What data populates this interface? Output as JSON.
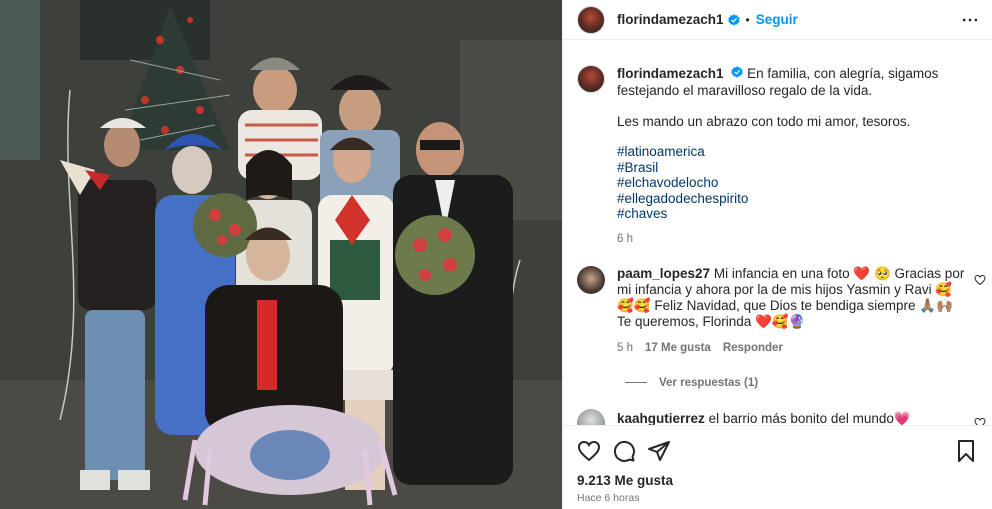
{
  "post": {
    "author": "florindamezach1",
    "verified": true,
    "follow_label": "Seguir",
    "separator": "•",
    "photo_icon": "photo-of-group-in-costumes"
  },
  "caption": {
    "author": "florindamezach1",
    "text": "En familia, con alegría, sigamos festejando el maravilloso regalo de la vida.",
    "text2": "Les mando un abrazo con todo mi amor, tesoros.",
    "hashtags": [
      "#latinoamerica",
      "#Brasil",
      "#elchavodelocho",
      "#ellegadodechespirito",
      "#chaves"
    ],
    "time": "6 h"
  },
  "comments": [
    {
      "author": "paam_lopes27",
      "text_parts": [
        "Mi infancia en una foto ",
        "❤️",
        " 🥺 ",
        "Gracias por mi infancia y ahora por la de mis hijos Yasmin y Ravi ",
        "🥰🥰🥰",
        " Feliz Navidad, que Dios te bendiga siempre ",
        "🙏🏽🙌🏽",
        " Te queremos, Florinda ",
        "❤️🥰🔮"
      ],
      "time": "5 h",
      "likes": "17 Me gusta",
      "reply_label": "Responder",
      "view_replies": "Ver respuestas (1)"
    },
    {
      "author": "kaahgutierrez",
      "text_parts": [
        "el barrio más bonito del mundo",
        "💗"
      ]
    }
  ],
  "footer": {
    "likes": "9.213 Me gusta",
    "time_ago": "Hace 6 horas"
  },
  "colors": {
    "accent": "#0095f6",
    "hashtag": "#00376b",
    "muted": "#737373",
    "verified": "#0095f6",
    "heart": "#ed4956"
  }
}
